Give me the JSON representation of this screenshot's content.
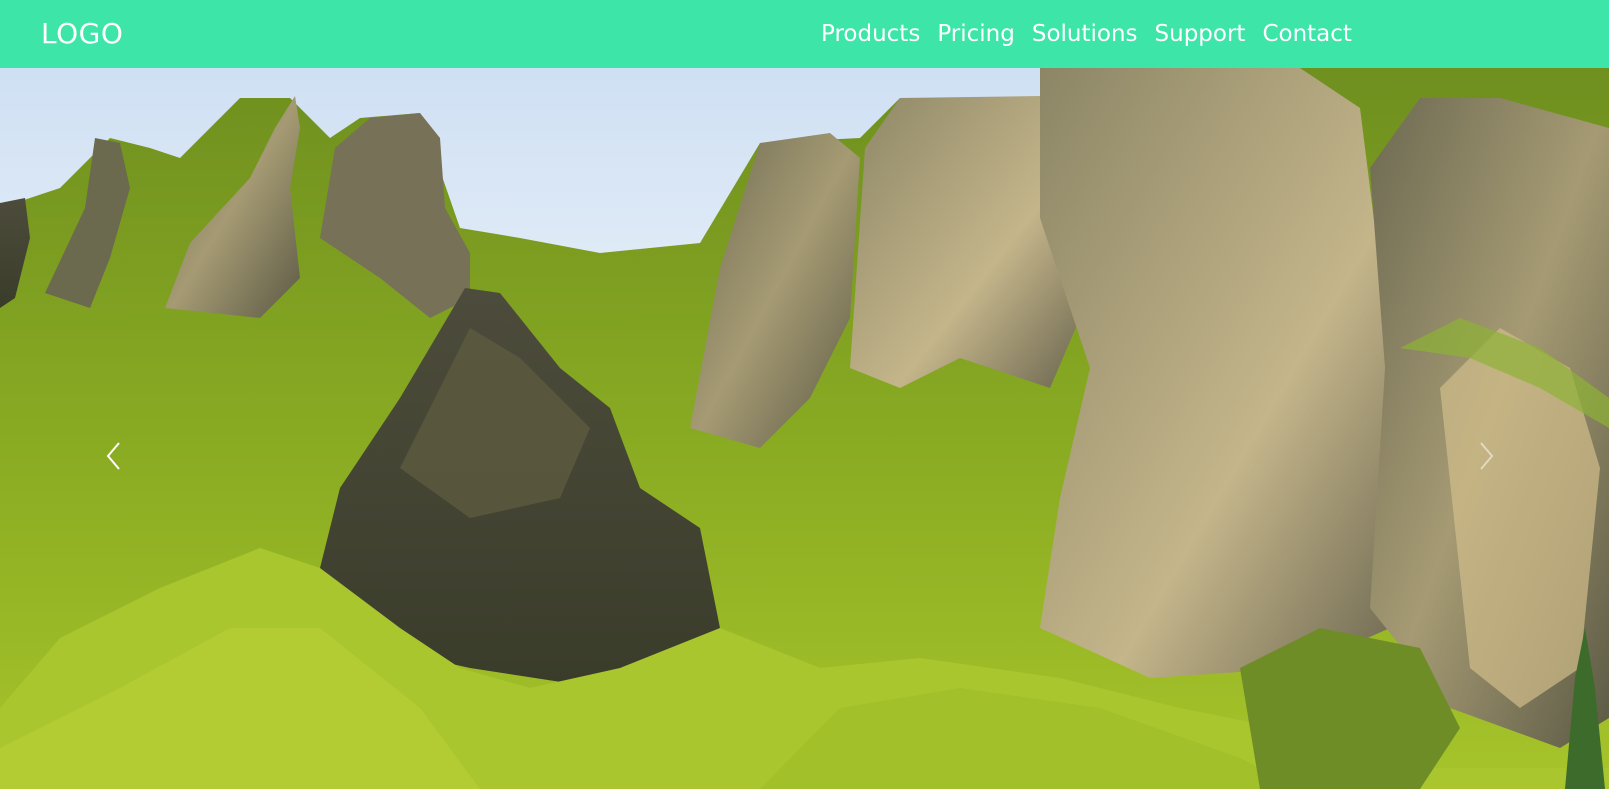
{
  "header": {
    "logo_text": "LOGO",
    "background_color": "#3de5a9",
    "nav": [
      {
        "label": "Products"
      },
      {
        "label": "Pricing"
      },
      {
        "label": "Solutions"
      },
      {
        "label": "Support"
      },
      {
        "label": "Contact"
      }
    ]
  },
  "carousel": {
    "prev_icon": "chevron-left-icon",
    "next_icon": "chevron-right-icon",
    "slide_image": "mossy-rock-mountains-landscape"
  }
}
